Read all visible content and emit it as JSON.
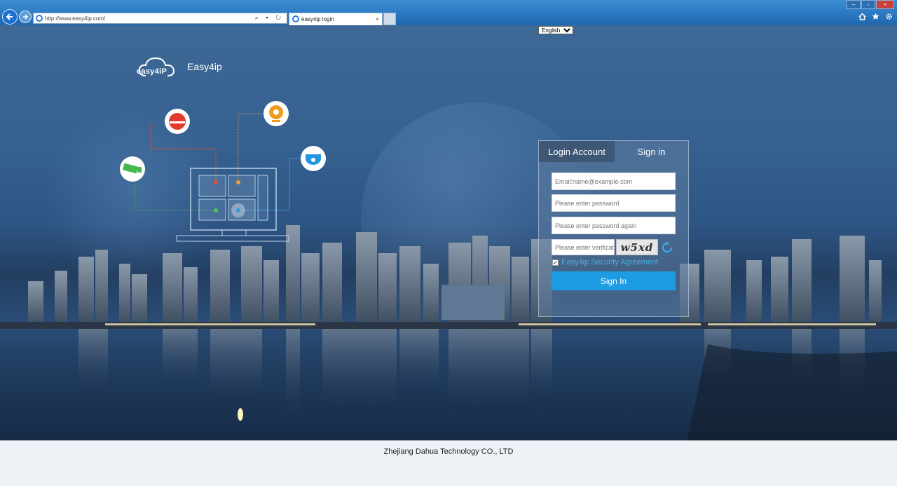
{
  "browser": {
    "url": "http://www.easy4ip.com/",
    "tab_title": "easy4ip login",
    "tab_close": "×",
    "back_icon": "back-arrow-icon",
    "forward_icon": "forward-arrow-icon",
    "address_tools": "⌕ ▾ ↻",
    "window_controls": [
      "–",
      "▫",
      "×"
    ],
    "toolbar_icons": [
      "home-icon",
      "favorites-star-icon",
      "settings-gear-icon"
    ]
  },
  "language": {
    "selected": "English"
  },
  "brand": {
    "logo_text": "easy4iP",
    "name": "Easy4ip"
  },
  "login": {
    "tabs": [
      {
        "label": "Login Account",
        "active": true
      },
      {
        "label": "Sign in",
        "active": false
      }
    ],
    "email_placeholder": "Email:name@example.com",
    "password_placeholder": "Please enter password",
    "password_again_placeholder": "Please enter password again",
    "captcha_placeholder": "Please enter verification code",
    "captcha_text": "w5xd",
    "agreement_checked": true,
    "agreement_label": "Easy4ip Security Agreement",
    "submit_label": "Sign In"
  },
  "footer": {
    "copyright": "Zhejiang Dahua Technology CO., LTD"
  },
  "colors": {
    "accent": "#1e9ce3",
    "link": "#4ab0e8",
    "chrome": "#2a78c2"
  }
}
